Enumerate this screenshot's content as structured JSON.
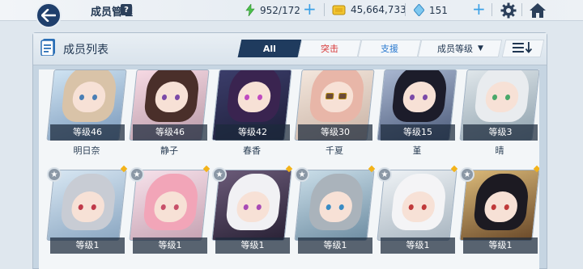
{
  "header": {
    "title": "成员管理",
    "help_label": "?",
    "stamina": "952/172",
    "credits": "45,664,733",
    "gems": "151"
  },
  "panel": {
    "title": "成员列表",
    "tabs": [
      {
        "label": "All",
        "active": true
      },
      {
        "label": "突击",
        "color": "#d83a3a"
      },
      {
        "label": "支援",
        "color": "#2a7ad0"
      }
    ],
    "sort_label": "成员等级",
    "sort_direction_icon": "sort-descending-icon"
  },
  "members_row1": [
    {
      "level": "等级46",
      "name": "明日奈"
    },
    {
      "level": "等级46",
      "name": "静子"
    },
    {
      "level": "等级42",
      "name": "春香"
    },
    {
      "level": "等级30",
      "name": "千夏"
    },
    {
      "level": "等级15",
      "name": "堇"
    },
    {
      "level": "等级3",
      "name": "晴"
    }
  ],
  "members_row2": [
    {
      "level": "等级1"
    },
    {
      "level": "等级1"
    },
    {
      "level": "等级1"
    },
    {
      "level": "等级1"
    },
    {
      "level": "等级1"
    },
    {
      "level": "等级1"
    }
  ],
  "colors": {
    "accent": "#1f3b5e",
    "striker": "#d83a3a",
    "special": "#2a7ad0",
    "stamina": "#4cc04c",
    "new_dot": "#f3b31a"
  }
}
